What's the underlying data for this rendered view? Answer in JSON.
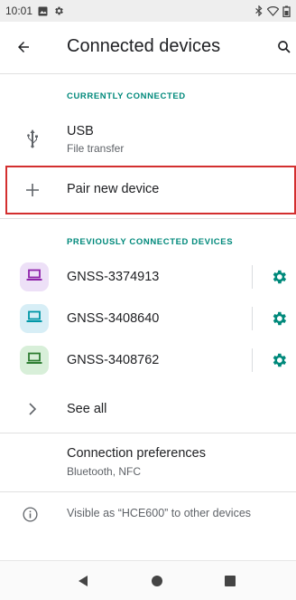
{
  "status_bar": {
    "time": "10:01",
    "left_icons": [
      "notification-image-icon",
      "gear-icon"
    ],
    "right_icons": [
      "bluetooth-icon",
      "wifi-icon",
      "battery-icon"
    ]
  },
  "app_bar": {
    "title": "Connected devices",
    "back_icon": "arrow-back-icon",
    "search_icon": "search-icon"
  },
  "currently_connected": {
    "header": "CURRENTLY CONNECTED",
    "usb": {
      "title": "USB",
      "subtitle": "File transfer",
      "icon": "usb-icon"
    }
  },
  "pair_new_device": {
    "label": "Pair new device",
    "icon": "plus-icon",
    "highlighted": true,
    "highlight_color": "#d32f2f"
  },
  "previously_connected": {
    "header": "PREVIOUSLY CONNECTED DEVICES",
    "devices": [
      {
        "name": "GNSS-3374913",
        "icon": "laptop-icon",
        "badge_color": "#ede0f7",
        "icon_color": "#8e24aa"
      },
      {
        "name": "GNSS-3408640",
        "icon": "laptop-icon",
        "badge_color": "#d7eef6",
        "icon_color": "#0097a7"
      },
      {
        "name": "GNSS-3408762",
        "icon": "laptop-icon",
        "badge_color": "#d8efd9",
        "icon_color": "#2e7d32"
      }
    ],
    "gear_color": "#00897b",
    "see_all": "See all"
  },
  "connection_preferences": {
    "title": "Connection preferences",
    "subtitle": "Bluetooth, NFC"
  },
  "visibility_info": {
    "text": "Visible as “HCE600” to other devices",
    "icon": "info-icon"
  },
  "nav_bar": {
    "buttons": [
      "back-triangle-icon",
      "home-circle-icon",
      "recents-square-icon"
    ]
  },
  "colors": {
    "accent": "#00897b",
    "text_primary": "#202124",
    "text_secondary": "#5f6368"
  }
}
